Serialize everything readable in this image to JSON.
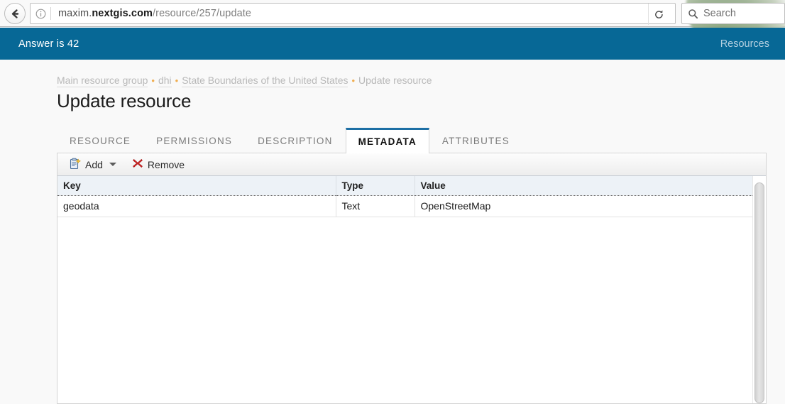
{
  "browser": {
    "back_icon": "back-arrow-icon",
    "identity_icon": "info-circle-icon",
    "url_prefix": "maxim.",
    "url_host_bold": "nextgis.com",
    "url_path": "/resource/257/update",
    "url_full": "maxim.nextgis.com/resource/257/update",
    "reload_icon": "reload-icon",
    "search_icon": "search-icon",
    "search_placeholder": "Search",
    "search_value": ""
  },
  "header": {
    "title": "Answer is 42",
    "resources_link": "Resources",
    "background_color": "#076896"
  },
  "breadcrumb": {
    "separator": "•",
    "separator_color": "#f0ad4e",
    "items": [
      {
        "label": "Main resource group",
        "is_link": true
      },
      {
        "label": "dhi",
        "is_link": true
      },
      {
        "label": "State Boundaries of the United States",
        "is_link": true
      },
      {
        "label": "Update resource",
        "is_link": false
      }
    ]
  },
  "page": {
    "title": "Update resource"
  },
  "tabs": {
    "active_index": 3,
    "active_accent_color": "#1d6fa5",
    "items": [
      {
        "label": "RESOURCE"
      },
      {
        "label": "PERMISSIONS"
      },
      {
        "label": "DESCRIPTION"
      },
      {
        "label": "METADATA"
      },
      {
        "label": "ATTRIBUTES"
      }
    ]
  },
  "toolbar": {
    "add_label": "Add",
    "add_icon": "new-document-icon",
    "add_caret_icon": "chevron-down-icon",
    "remove_label": "Remove",
    "remove_icon": "red-x-icon",
    "remove_icon_color": "#cc2222"
  },
  "grid": {
    "columns": [
      "Key",
      "Type",
      "Value"
    ],
    "rows": [
      {
        "key": "geodata",
        "type": "Text",
        "value": "OpenStreetMap"
      }
    ]
  }
}
